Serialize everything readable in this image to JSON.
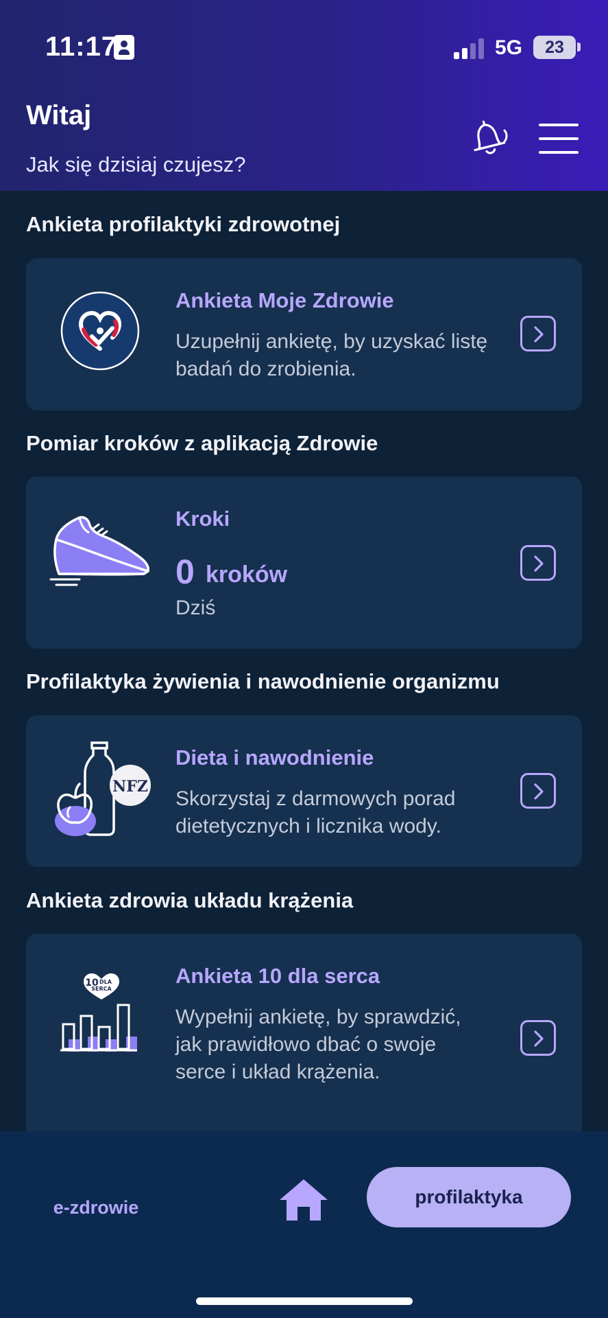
{
  "status_bar": {
    "time": "11:17",
    "network": "5G",
    "battery": "23"
  },
  "header": {
    "greeting": "Witaj",
    "subtitle": "Jak się dzisiaj czujesz?"
  },
  "sections": [
    {
      "title": "Ankieta profilaktyki zdrowotnej",
      "card": {
        "title": "Ankieta Moje Zdrowie",
        "text": "Uzupełnij ankietę, by uzyskać listę badań do zrobienia.",
        "icon": "heart-check-icon"
      }
    },
    {
      "title": "Pomiar kroków z aplikacją Zdrowie",
      "card": {
        "title": "Kroki",
        "steps_value": "0",
        "steps_unit": "kroków",
        "period": "Dziś",
        "icon": "sneaker-icon"
      }
    },
    {
      "title": "Profilaktyka żywienia i nawodnienie organizmu",
      "card": {
        "title": "Dieta i nawodnienie",
        "text": "Skorzystaj z darmowych porad dietetycznych i licznika wody.",
        "icon": "apple-bottle-icon",
        "badge": "NFZ"
      }
    },
    {
      "title": "Ankieta zdrowia układu krążenia",
      "card": {
        "title": "Ankieta 10 dla serca",
        "text": "Wypełnij ankietę, by sprawdzić, jak prawidłowo dbać o swoje serce i układ krążenia.",
        "icon": "ten-for-heart-icon",
        "badge_number": "10",
        "badge_line1": "DLA",
        "badge_line2": "SERCA"
      }
    }
  ],
  "bottom_nav": {
    "left": "e-zdrowie",
    "center_icon": "home-icon",
    "right": "profilaktyka"
  },
  "colors": {
    "accent": "#b7a7ff",
    "background": "#0d2137",
    "card": "#16304f",
    "nav_active": "#b8b1f5"
  }
}
